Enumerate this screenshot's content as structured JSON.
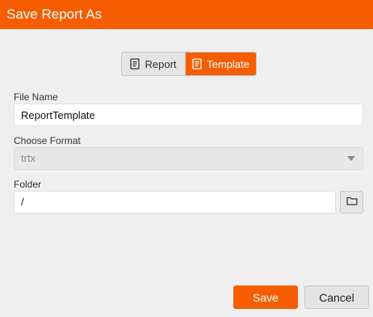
{
  "dialog": {
    "title": "Save Report As"
  },
  "type_toggle": {
    "options": [
      {
        "label": "Report",
        "icon": "report-icon",
        "selected": false
      },
      {
        "label": "Template",
        "icon": "template-icon",
        "selected": true
      }
    ]
  },
  "file_name": {
    "label": "File Name",
    "value": "ReportTemplate"
  },
  "format": {
    "label": "Choose Format",
    "selected": "trtx"
  },
  "folder": {
    "label": "Folder",
    "value": "/",
    "browse_icon": "folder-icon"
  },
  "actions": {
    "save_label": "Save",
    "cancel_label": "Cancel"
  },
  "colors": {
    "accent": "#f55d00",
    "background": "#efefef"
  }
}
